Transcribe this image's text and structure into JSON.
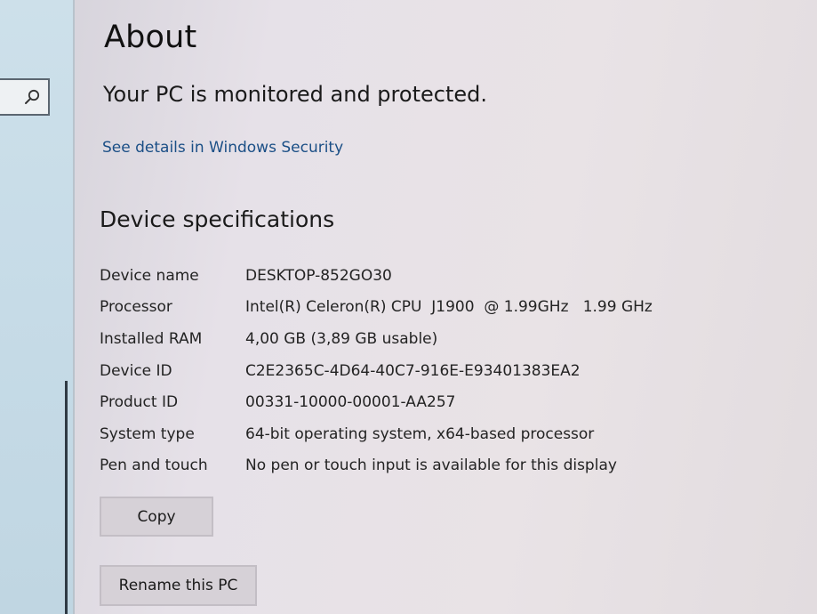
{
  "nav": {
    "search_icon": "search-icon"
  },
  "about": {
    "title": "About",
    "protection_status": "Your PC is monitored and protected.",
    "security_link": "See details in Windows Security"
  },
  "device_specs": {
    "title": "Device specifications",
    "rows": [
      {
        "label": "Device name",
        "value": "DESKTOP-852GO30"
      },
      {
        "label": "Processor",
        "value": "Intel(R) Celeron(R) CPU  J1900  @ 1.99GHz   1.99 GHz"
      },
      {
        "label": "Installed RAM",
        "value": "4,00 GB (3,89 GB usable)"
      },
      {
        "label": "Device ID",
        "value": "C2E2365C-4D64-40C7-916E-E93401383EA2"
      },
      {
        "label": "Product ID",
        "value": "00331-10000-00001-AA257"
      },
      {
        "label": "System type",
        "value": "64-bit operating system, x64-based processor"
      },
      {
        "label": "Pen and touch",
        "value": "No pen or touch input is available for this display"
      }
    ],
    "copy_label": "Copy",
    "rename_label": "Rename this PC"
  },
  "colors": {
    "link": "#1b4f86",
    "button_bg": "#d6d1d7",
    "nav_bg": "#c6dbe7"
  }
}
